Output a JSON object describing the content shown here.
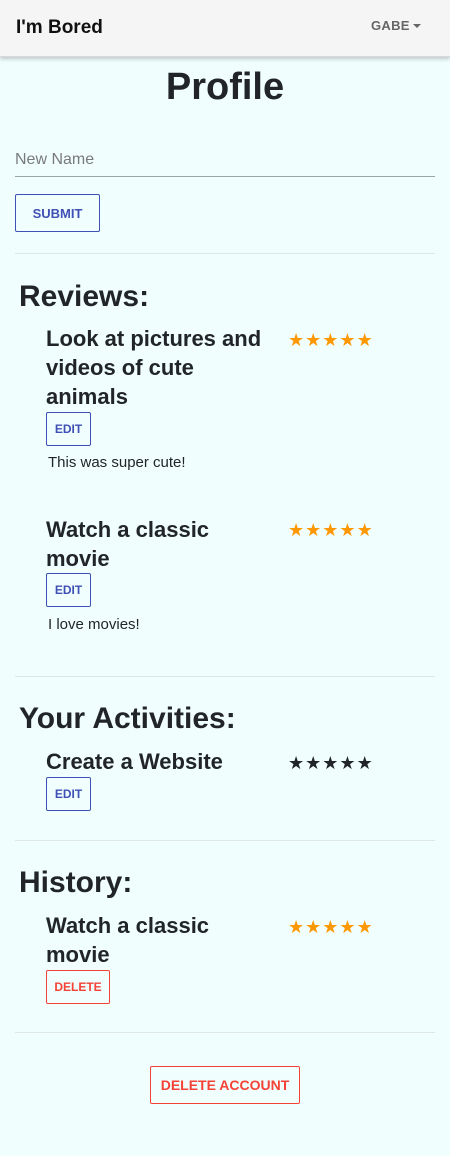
{
  "app": {
    "brand": "I'm Bored",
    "user": "GABE"
  },
  "page": {
    "title": "Profile"
  },
  "name_form": {
    "placeholder": "New Name",
    "value": "",
    "submit_label": "SUBMIT"
  },
  "reviews": {
    "heading": "Reviews:",
    "items": [
      {
        "title": "Look at pictures and videos of cute animals",
        "rating": 5,
        "edit_label": "EDIT",
        "comment": "This was super cute!"
      },
      {
        "title": "Watch a classic movie",
        "rating": 5,
        "edit_label": "EDIT",
        "comment": "I love movies!"
      }
    ]
  },
  "activities": {
    "heading": "Your Activities:",
    "items": [
      {
        "title": "Create a Website",
        "rating": 5,
        "edit_label": "EDIT"
      }
    ]
  },
  "history": {
    "heading": "History:",
    "items": [
      {
        "title": "Watch a classic movie",
        "rating": 5,
        "delete_label": "DELETE"
      }
    ]
  },
  "footer": {
    "delete_account_label": "DELETE ACCOUNT"
  },
  "colors": {
    "background": "#f0fefe",
    "primary": "#3f51b5",
    "danger": "#f44336",
    "star_rated": "#ff9800",
    "star_activity": "#212529"
  },
  "icons": {
    "star": "star-icon",
    "caret": "caret-down-icon"
  }
}
